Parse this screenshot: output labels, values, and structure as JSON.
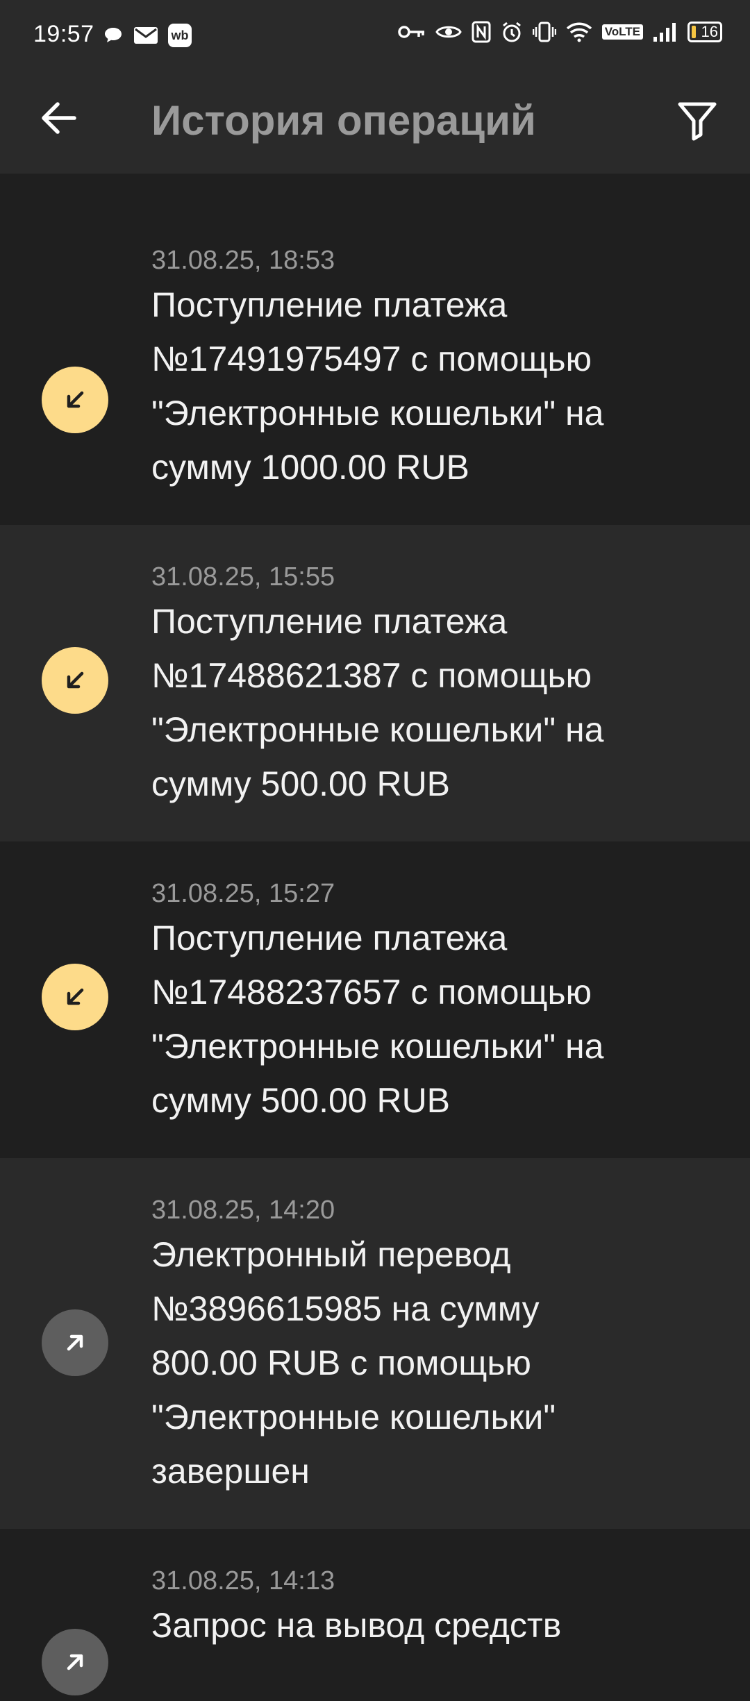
{
  "status_bar": {
    "time": "19:57",
    "left_icons": [
      "chat-bubble-icon",
      "mail-icon",
      "wb-app-icon"
    ],
    "right_icons": [
      "key-icon",
      "eye-icon",
      "nfc-icon",
      "alarm-icon",
      "vibrate-icon",
      "wifi-icon",
      "volte-icon",
      "signal-icon",
      "battery-icon"
    ],
    "volte_label": "VoLTE",
    "battery_level": "16",
    "wb_label": "wb"
  },
  "app_bar": {
    "title": "История операций",
    "back_icon": "arrow-left-icon",
    "filter_icon": "filter-icon"
  },
  "colors": {
    "background": "#1f1f1f",
    "row_alt": "#2a2a2a",
    "incoming_icon_bg": "#fddb8a",
    "outgoing_icon_bg": "#5e5e5e",
    "secondary_text": "#9a9a9a"
  },
  "operations": [
    {
      "date": "31.08.25, 18:53",
      "direction": "in",
      "icon": "arrow-down-left-icon",
      "lines": [
        "Поступление платежа",
        "№17491975497 с помощью",
        "\"Электронные кошельки\" на",
        "сумму 1000.00 RUB"
      ]
    },
    {
      "date": "31.08.25, 15:55",
      "direction": "in",
      "icon": "arrow-down-left-icon",
      "lines": [
        "Поступление платежа",
        "№17488621387 с помощью",
        "\"Электронные кошельки\" на",
        "сумму 500.00 RUB"
      ]
    },
    {
      "date": "31.08.25, 15:27",
      "direction": "in",
      "icon": "arrow-down-left-icon",
      "lines": [
        "Поступление платежа",
        "№17488237657 с помощью",
        "\"Электронные кошельки\" на",
        "сумму 500.00 RUB"
      ]
    },
    {
      "date": "31.08.25, 14:20",
      "direction": "out",
      "icon": "arrow-up-right-icon",
      "lines": [
        "Электронный перевод",
        "№3896615985 на сумму",
        "800.00 RUB с помощью",
        "\"Электронные кошельки\"",
        "завершен"
      ]
    },
    {
      "date": "31.08.25, 14:13",
      "direction": "out",
      "icon": "arrow-up-right-icon",
      "lines": [
        "Запрос на вывод средств"
      ]
    }
  ]
}
